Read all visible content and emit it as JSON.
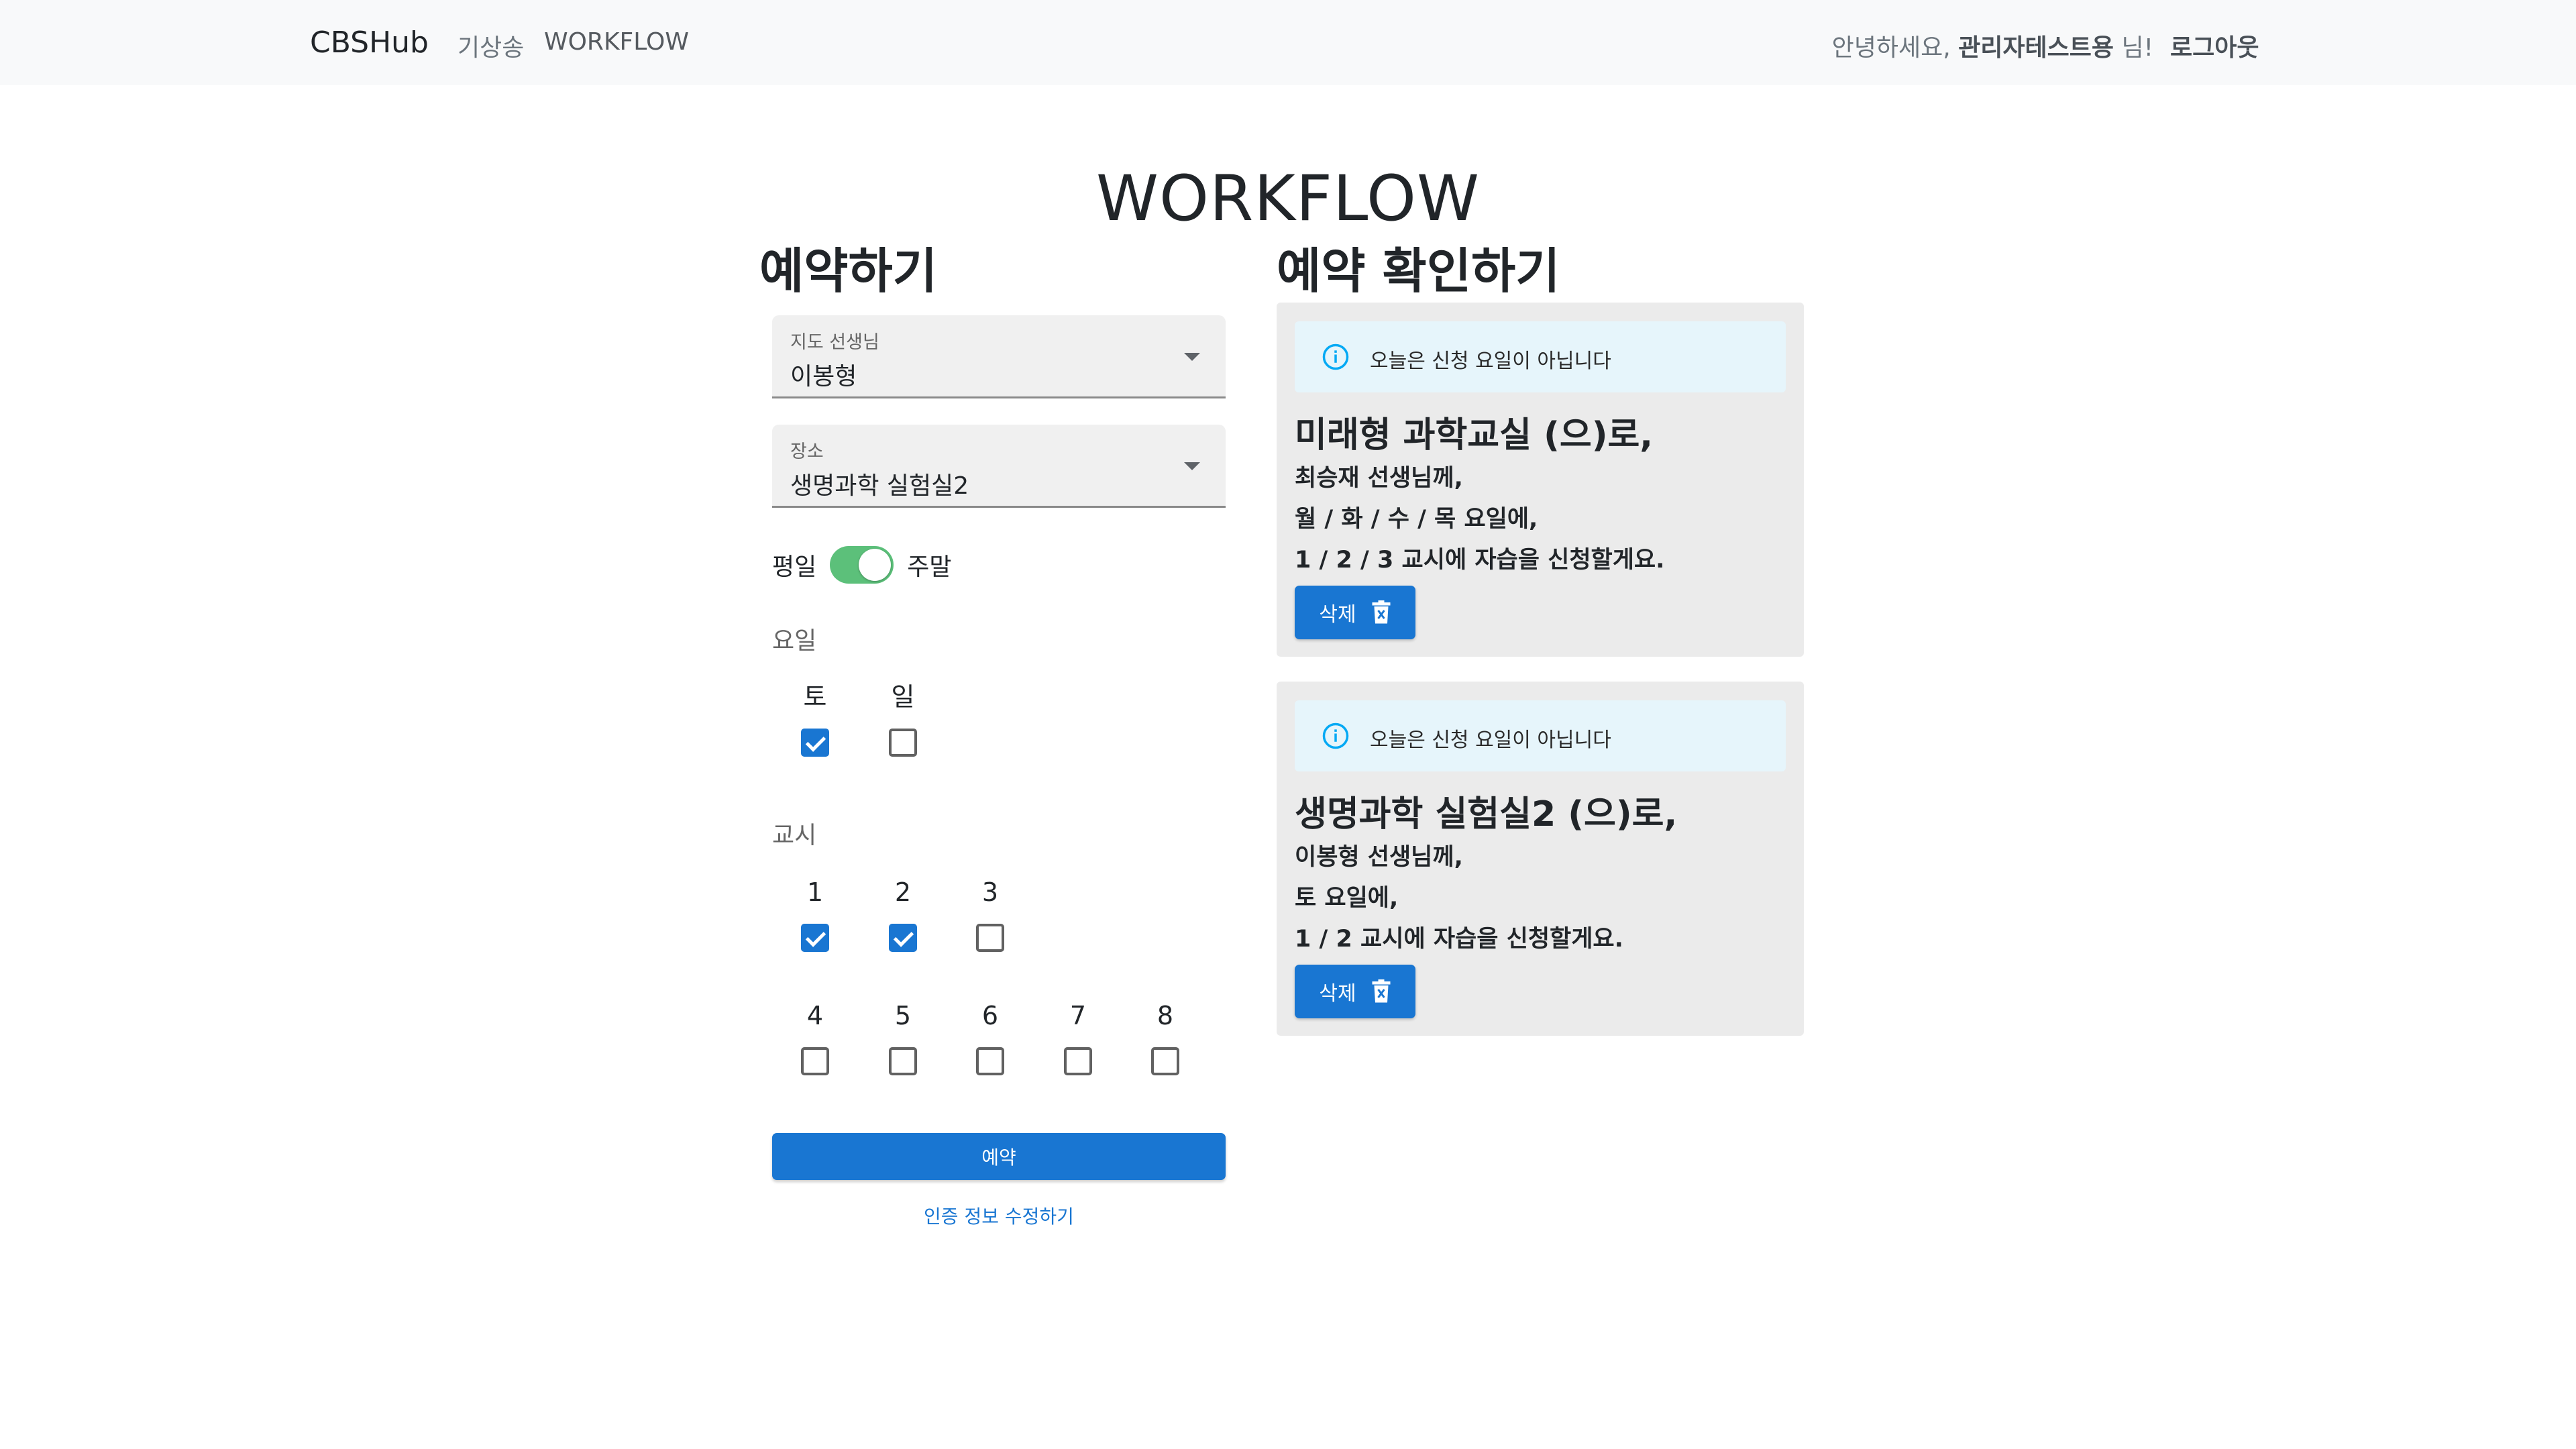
{
  "navbar": {
    "brand": "CBSHub",
    "links": [
      "기상송",
      "WORKFLOW"
    ],
    "greeting_prefix": "안녕하세요, ",
    "user_name": "관리자테스트용",
    "greeting_suffix": " 님!",
    "logout": "로그아웃"
  },
  "page": {
    "title": "WORKFLOW"
  },
  "form": {
    "heading": "예약하기",
    "teacher": {
      "label": "지도 선생님",
      "value": "이봉형"
    },
    "place": {
      "label": "장소",
      "value": "생명과학 실험실2"
    },
    "toggle": {
      "left": "평일",
      "right": "주말",
      "on": true
    },
    "days": {
      "label": "요일",
      "items": [
        {
          "name": "토",
          "checked": true
        },
        {
          "name": "일",
          "checked": false
        }
      ]
    },
    "periods": {
      "label": "교시",
      "row1": [
        {
          "name": "1",
          "checked": true
        },
        {
          "name": "2",
          "checked": true
        },
        {
          "name": "3",
          "checked": false
        }
      ],
      "row2": [
        {
          "name": "4",
          "checked": false
        },
        {
          "name": "5",
          "checked": false
        },
        {
          "name": "6",
          "checked": false
        },
        {
          "name": "7",
          "checked": false
        },
        {
          "name": "8",
          "checked": false
        }
      ]
    },
    "submit": "예약",
    "edit_link": "인증 정보 수정하기"
  },
  "reservations": {
    "heading": "예약 확인하기",
    "items": [
      {
        "alert": "오늘은 신청 요일이 아닙니다",
        "title": "미래형 과학교실 (으)로,",
        "teacher": "최승재 선생님께,",
        "days": "월 / 화 / 수 / 목 요일에,",
        "periods": "1 / 2 / 3 교시에 자습을 신청할게요.",
        "delete": "삭제"
      },
      {
        "alert": "오늘은 신청 요일이 아닙니다",
        "title": "생명과학 실험실2 (으)로,",
        "teacher": "이봉형 선생님께,",
        "days": "토 요일에,",
        "periods": "1 / 2 교시에 자습을 신청할게요.",
        "delete": "삭제"
      }
    ]
  },
  "colors": {
    "primary": "#1976d2",
    "navbar_bg": "#f8f9fa",
    "card_bg": "#ebebeb",
    "alert_bg": "#e6f5fb",
    "toggle_on": "#5cc07a",
    "info_icon": "#03a9f4"
  },
  "icons": [
    "info-icon",
    "trash-icon",
    "dropdown-caret-icon"
  ]
}
